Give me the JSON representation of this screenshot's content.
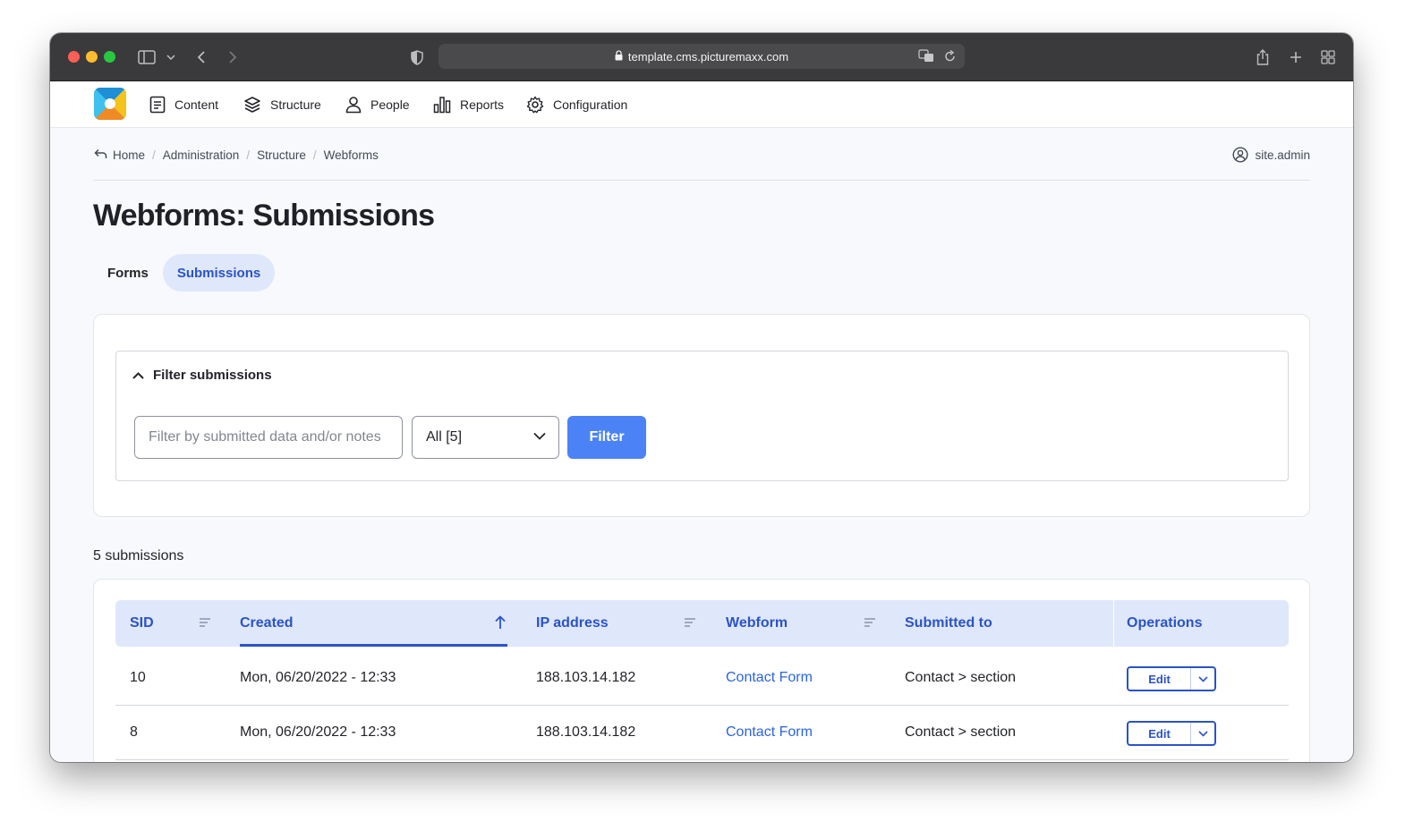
{
  "browser": {
    "url": "template.cms.picturemaxx.com"
  },
  "nav": {
    "items": [
      {
        "label": "Content",
        "icon": "document-icon"
      },
      {
        "label": "Structure",
        "icon": "layers-icon"
      },
      {
        "label": "People",
        "icon": "person-icon"
      },
      {
        "label": "Reports",
        "icon": "bar-chart-icon"
      },
      {
        "label": "Configuration",
        "icon": "gear-icon"
      }
    ]
  },
  "breadcrumb": {
    "items": [
      "Home",
      "Administration",
      "Structure",
      "Webforms"
    ]
  },
  "user": {
    "name": "site.admin"
  },
  "page": {
    "title": "Webforms: Submissions"
  },
  "tabs": [
    {
      "label": "Forms",
      "active": false
    },
    {
      "label": "Submissions",
      "active": true
    }
  ],
  "filter": {
    "legend": "Filter submissions",
    "search_placeholder": "Filter by submitted data and/or notes",
    "select_value": "All [5]",
    "button_label": "Filter"
  },
  "summary": {
    "count": "5 submissions"
  },
  "table": {
    "columns": [
      "SID",
      "Created",
      "IP address",
      "Webform",
      "Submitted to",
      "Operations"
    ],
    "rows": [
      {
        "sid": "10",
        "created": "Mon, 06/20/2022 - 12:33",
        "ip": "188.103.14.182",
        "webform": "Contact Form",
        "submitted_to": "Contact > section",
        "op": "Edit"
      },
      {
        "sid": "8",
        "created": "Mon, 06/20/2022 - 12:33",
        "ip": "188.103.14.182",
        "webform": "Contact Form",
        "submitted_to": "Contact > section",
        "op": "Edit"
      }
    ]
  },
  "colors": {
    "accent": "#2a53c8",
    "button": "#4b83f6",
    "header_bg": "#dfe7fa",
    "link": "#2a64e0"
  }
}
